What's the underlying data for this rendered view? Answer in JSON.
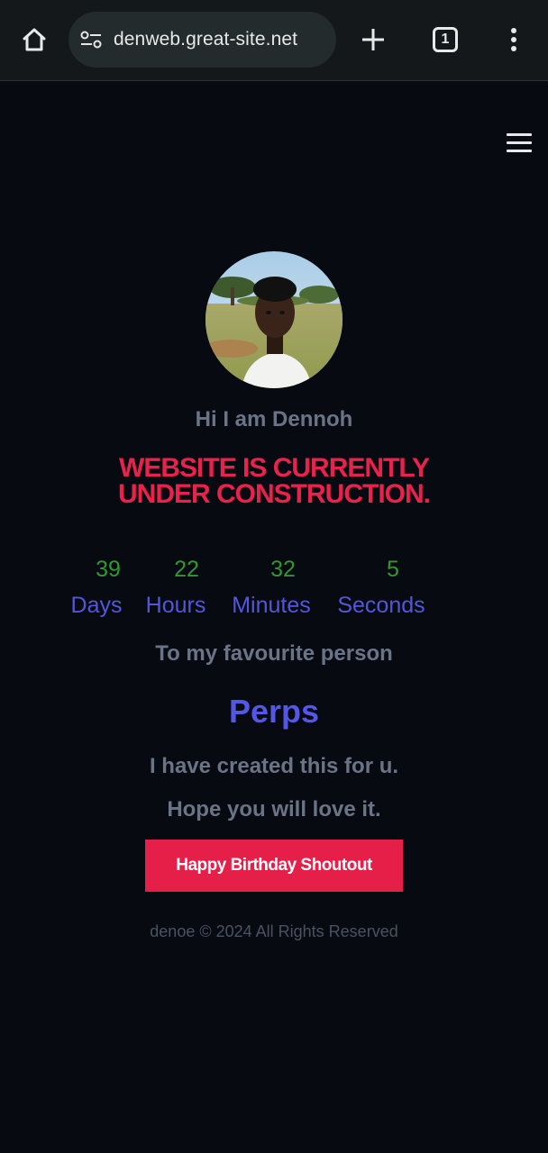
{
  "browser": {
    "url": "denweb.great-site.net",
    "tab_count": "1"
  },
  "profile": {
    "greeting": "Hi I am Dennoh"
  },
  "headline": {
    "line1": "WEBSITE IS CURRENTLY",
    "line2": "UNDER CONSTRUCTION."
  },
  "countdown": {
    "days": "39",
    "hours": "22",
    "minutes": "32",
    "seconds": "5",
    "days_label": "Days",
    "hours_label": "Hours",
    "minutes_label": "Minutes",
    "seconds_label": "Seconds"
  },
  "message": {
    "to": "To my favourite person",
    "name": "Perps",
    "line1": "I have created this for u.",
    "line2": "Hope you will love it."
  },
  "cta": {
    "label": "Happy Birthday Shoutout"
  },
  "footer": {
    "text": "denoe © 2024 All Rights Reserved"
  },
  "colors": {
    "background": "#080a12",
    "accent_red": "#e61f49",
    "accent_purple": "#5356e6",
    "countdown_green": "#2e9a2e",
    "muted_text": "#6b7486"
  },
  "icons": {
    "home": "home-icon",
    "site_info": "site-settings-icon",
    "new_tab": "plus-icon",
    "tabs": "tab-switcher-icon",
    "more": "more-vert-icon",
    "menu": "hamburger-menu-icon"
  }
}
